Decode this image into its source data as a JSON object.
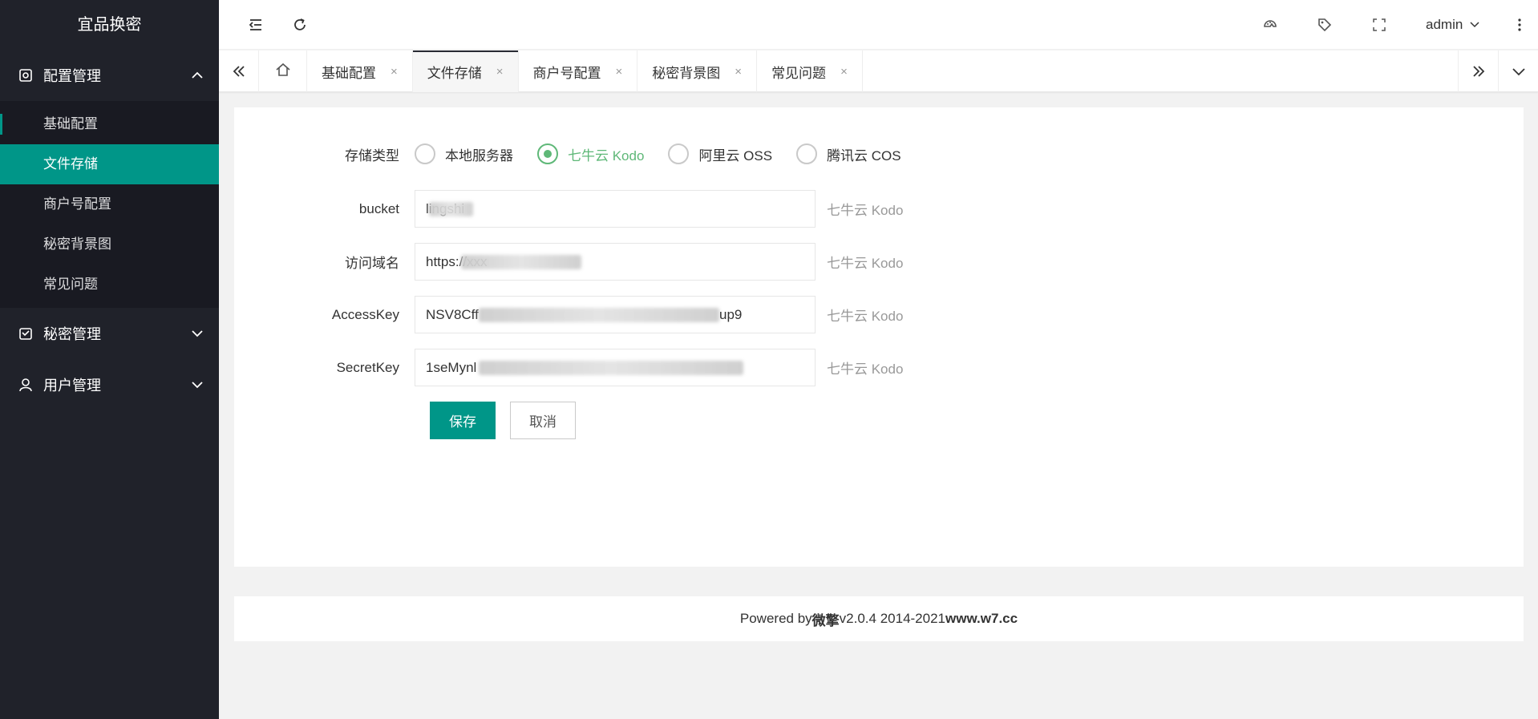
{
  "app": {
    "title": "宜品换密"
  },
  "sidebar": {
    "groups": [
      {
        "label": "配置管理",
        "icon": "settings-icon",
        "expanded": true,
        "items": [
          {
            "label": "基础配置"
          },
          {
            "label": "文件存储",
            "active": true
          },
          {
            "label": "商户号配置"
          },
          {
            "label": "秘密背景图"
          },
          {
            "label": "常见问题"
          }
        ]
      },
      {
        "label": "秘密管理",
        "icon": "message-icon",
        "expanded": false
      },
      {
        "label": "用户管理",
        "icon": "user-icon",
        "expanded": false
      }
    ]
  },
  "header": {
    "user": "admin",
    "icons": [
      "menu-fold-icon",
      "refresh-icon",
      "theme-icon",
      "tag-icon",
      "fullscreen-icon",
      "more-icon"
    ]
  },
  "tabs": {
    "items": [
      {
        "label": "基础配置",
        "close": "×"
      },
      {
        "label": "文件存储",
        "close": "×",
        "active": true
      },
      {
        "label": "商户号配置",
        "close": "×"
      },
      {
        "label": "秘密背景图",
        "close": "×"
      },
      {
        "label": "常见问题",
        "close": "×"
      }
    ]
  },
  "form": {
    "storage_label": "存储类型",
    "storage_options": [
      {
        "label": "本地服务器",
        "checked": false
      },
      {
        "label": "七牛云 Kodo",
        "checked": true
      },
      {
        "label": "阿里云 OSS",
        "checked": false
      },
      {
        "label": "腾讯云 COS",
        "checked": false
      }
    ],
    "fields": [
      {
        "label": "bucket",
        "value": "lingshi",
        "hint": "七牛云 Kodo"
      },
      {
        "label": "访问域名",
        "value": "https://xxx",
        "hint": "七牛云 Kodo"
      },
      {
        "label": "AccessKey",
        "value": "NSV8Cff",
        "value_tail": "up9",
        "hint": "七牛云 Kodo"
      },
      {
        "label": "SecretKey",
        "value": "1seMynl",
        "hint": "七牛云 Kodo"
      }
    ],
    "save_label": "保存",
    "cancel_label": "取消"
  },
  "footer": {
    "prefix": "Powered by ",
    "brand": "微擎",
    "version": " v2.0.4 2014-2021 ",
    "site": "www.w7.cc"
  },
  "colors": {
    "sidebar_bg": "#20222a",
    "accent": "#009688",
    "radio_checked": "#5fb878"
  }
}
